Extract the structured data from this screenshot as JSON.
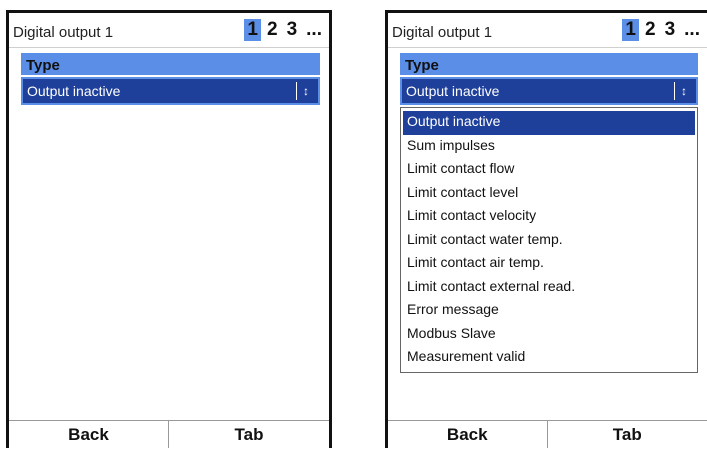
{
  "left_screen": {
    "title": "Digital output 1",
    "pages": [
      "1",
      "2",
      "3",
      "..."
    ],
    "active_page": "1",
    "group_header": "Type",
    "select_value": "Output inactive",
    "softkeys": {
      "left": "Back",
      "right": "Tab"
    }
  },
  "right_screen": {
    "title": "Digital output 1",
    "pages": [
      "1",
      "2",
      "3",
      "..."
    ],
    "active_page": "1",
    "group_header": "Type",
    "select_value": "Output inactive",
    "options": [
      "Output inactive",
      "Sum impulses",
      "Limit contact flow",
      "Limit contact level",
      "Limit contact velocity",
      "Limit contact water temp.",
      "Limit contact air temp.",
      "Limit contact external read.",
      "Error message",
      "Modbus Slave",
      "Measurement valid"
    ],
    "selected_option": "Output inactive",
    "softkeys": {
      "left": "Back",
      "right": "Tab"
    }
  },
  "colors": {
    "accent": "#5b8ee6",
    "selection": "#1e3f9a"
  },
  "icons": {
    "select_arrow": "up-down-arrow-icon"
  }
}
